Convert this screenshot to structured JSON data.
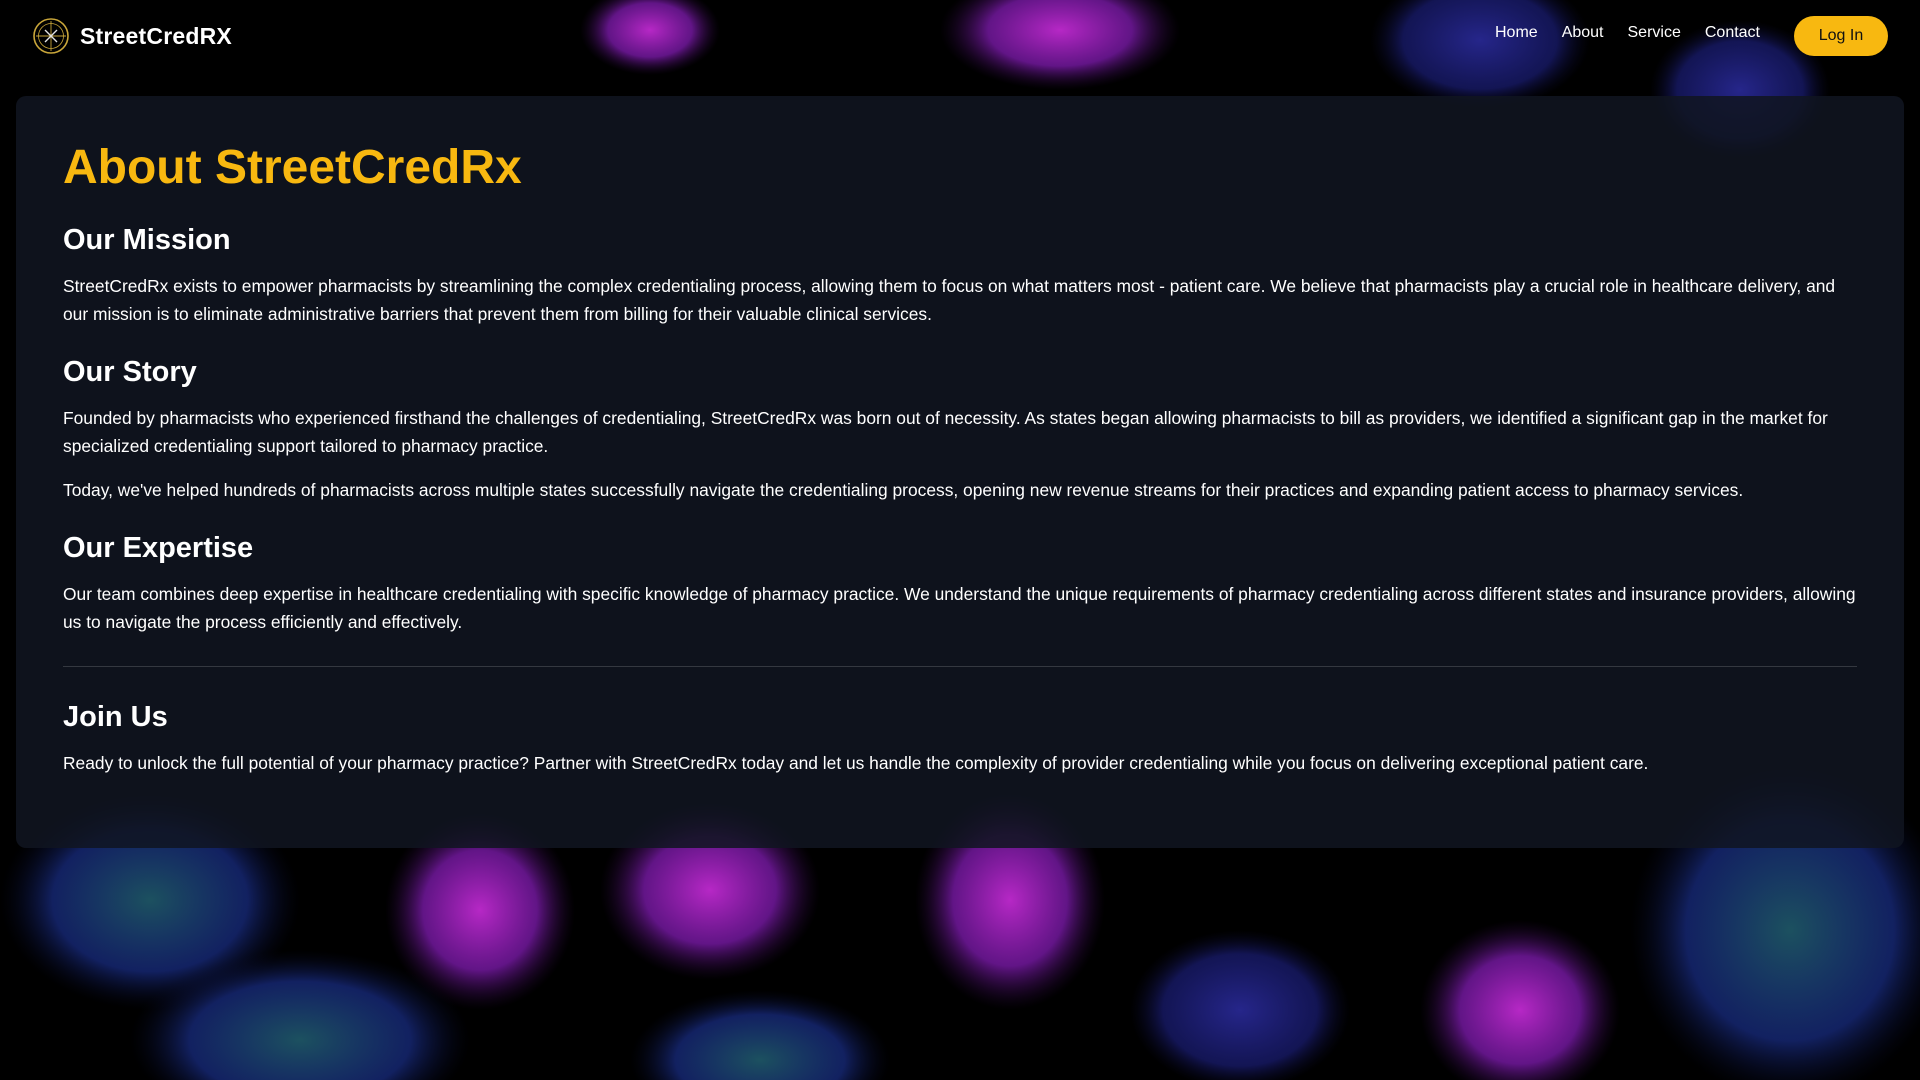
{
  "brand": {
    "name": "StreetCredRX",
    "logo_icon": "compass-logo-icon"
  },
  "nav": {
    "items": [
      {
        "label": "Home"
      },
      {
        "label": "About"
      },
      {
        "label": "Service"
      },
      {
        "label": "Contact"
      }
    ],
    "login_label": "Log In"
  },
  "about": {
    "title": "About StreetCredRx",
    "mission": {
      "heading": "Our Mission",
      "text": "StreetCredRx exists to empower pharmacists by streamlining the complex credentialing process, allowing them to focus on what matters most - patient care. We believe that pharmacists play a crucial role in healthcare delivery, and our mission is to eliminate administrative barriers that prevent them from billing for their valuable clinical services."
    },
    "story": {
      "heading": "Our Story",
      "paragraphs": [
        "Founded by pharmacists who experienced firsthand the challenges of credentialing, StreetCredRx was born out of necessity. As states began allowing pharmacists to bill as providers, we identified a significant gap in the market for specialized credentialing support tailored to pharmacy practice.",
        "Today, we've helped hundreds of pharmacists across multiple states successfully navigate the credentialing process, opening new revenue streams for their practices and expanding patient access to pharmacy services."
      ]
    },
    "expertise": {
      "heading": "Our Expertise",
      "text": "Our team combines deep expertise in healthcare credentialing with specific knowledge of pharmacy practice. We understand the unique requirements of pharmacy credentialing across different states and insurance providers, allowing us to navigate the process efficiently and effectively."
    },
    "join": {
      "heading": "Join Us",
      "text": "Ready to unlock the full potential of your pharmacy practice? Partner with StreetCredRx today and let us handle the complexity of provider credentialing while you focus on delivering exceptional patient care."
    }
  },
  "colors": {
    "accent": "#f8b810",
    "card_background": "#101521",
    "page_background": "#000000"
  }
}
